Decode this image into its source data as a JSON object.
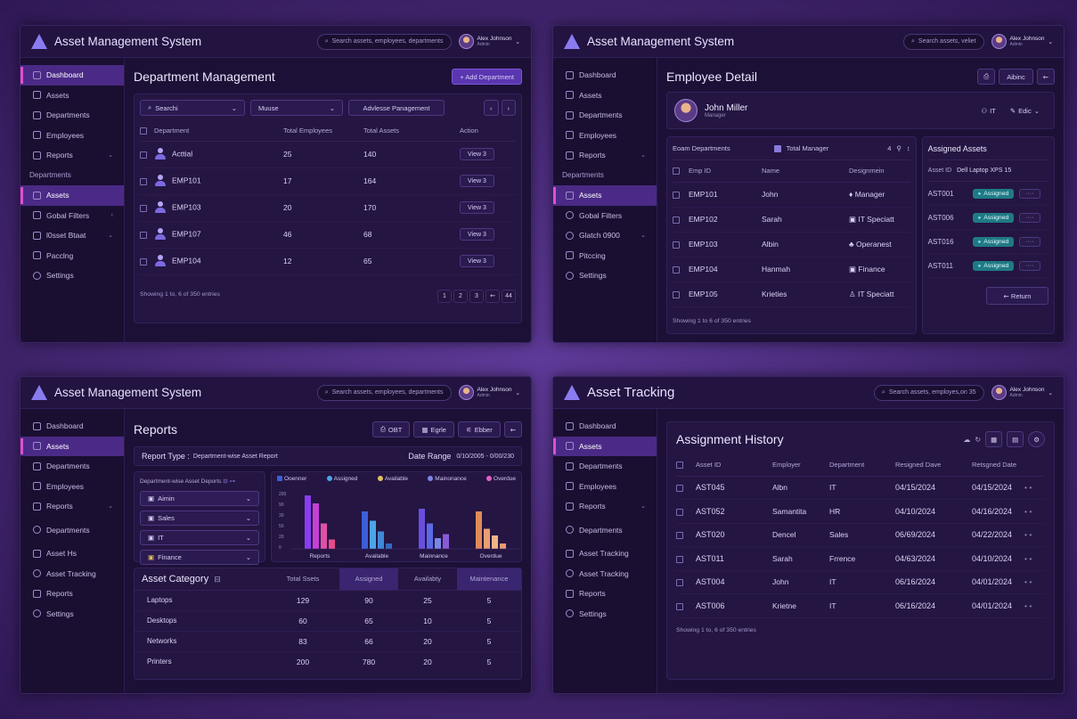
{
  "app_title": "Asset Management System",
  "user": {
    "name": "Alex Johnson",
    "role": "Admin"
  },
  "panel1": {
    "search": "Search assets, employees, departments",
    "nav": [
      {
        "label": "Dashboard",
        "chev": ""
      },
      {
        "label": "Assets",
        "chev": ""
      },
      {
        "label": "Departments",
        "chev": ""
      },
      {
        "label": "Employees",
        "chev": ""
      },
      {
        "label": "Reports",
        "chev": "⌄"
      },
      {
        "label": "Departments",
        "chev": ""
      },
      {
        "label": "Assets",
        "chev": ""
      },
      {
        "label": "Gobal Filters",
        "chev": "‹"
      },
      {
        "label": "l0sset Btaat",
        "chev": "⌄"
      },
      {
        "label": "Pacclng",
        "chev": ""
      },
      {
        "label": "Settings",
        "chev": ""
      }
    ],
    "title": "Department Management",
    "add_button": "+ Add Department",
    "filter_search": "Searchi",
    "filter_2": "Muuse",
    "filter_3": "Advlesse Panagement",
    "columns": [
      "Department",
      "Total Employees",
      "Total Assets",
      "Action"
    ],
    "rows": [
      {
        "dept": "Acttial",
        "emp": "25",
        "assets": "140",
        "action": "View 3"
      },
      {
        "dept": "EMP101",
        "emp": "17",
        "assets": "164",
        "action": "View 3"
      },
      {
        "dept": "EMP103",
        "emp": "20",
        "assets": "170",
        "action": "View 3"
      },
      {
        "dept": "EMP107",
        "emp": "46",
        "assets": "68",
        "action": "View 3"
      },
      {
        "dept": "EMP104",
        "emp": "12",
        "assets": "65",
        "action": "View 3"
      }
    ],
    "footer": "Showing 1 to, 6 of 350 entries",
    "pages": [
      "1",
      "2",
      "3",
      "⇜",
      "44"
    ]
  },
  "panel2": {
    "search": "Search assets, veliet",
    "nav": [
      {
        "label": "Dashboard",
        "chev": ""
      },
      {
        "label": "Assets",
        "chev": ""
      },
      {
        "label": "Departments",
        "chev": ""
      },
      {
        "label": "Employees",
        "chev": ""
      },
      {
        "label": "Reports",
        "chev": "⌄"
      },
      {
        "label": "Departments",
        "chev": ""
      },
      {
        "label": "Assets",
        "chev": ""
      },
      {
        "label": "Gobal Filters",
        "chev": ""
      },
      {
        "label": "Glatch 0900",
        "chev": "⌄"
      },
      {
        "label": "Pitccing",
        "chev": ""
      },
      {
        "label": "Settings",
        "chev": ""
      }
    ],
    "title": "Employee Detail",
    "top_button": "Aibinc",
    "employee": {
      "name": "John Miller",
      "role": "Manager",
      "dept": "IT",
      "edit": "Edic"
    },
    "bar_left": "Eoam Departments",
    "bar_mid": "Total Manager",
    "bar_count": "4",
    "columns": [
      "Emp ID",
      "Name",
      "Designmein"
    ],
    "rows": [
      {
        "id": "EMP101",
        "name": "John",
        "role": "Manager"
      },
      {
        "id": "EMP102",
        "name": "Sarah",
        "role": "IT Speciatt"
      },
      {
        "id": "EMP103",
        "name": "Albin",
        "role": "Operanest"
      },
      {
        "id": "EMP104",
        "name": "Hanmah",
        "role": "Finance"
      },
      {
        "id": "EMP105",
        "name": "Krieties",
        "role": "IT Speciatt"
      }
    ],
    "footer": "Showing 1 to 6 of 350 entries",
    "assigned": {
      "title": "Assigned Assets",
      "col1": "Asset ID",
      "col2": "Dell Laptop XPS 15",
      "rows": [
        {
          "id": "AST001",
          "status": "Assigned"
        },
        {
          "id": "AST006",
          "status": "Assigned"
        },
        {
          "id": "AST016",
          "status": "Assigned"
        },
        {
          "id": "AST011",
          "status": "Assigned"
        }
      ],
      "return": "⇜ Return"
    }
  },
  "panel3": {
    "search": "Search assets, employees, departments",
    "nav": [
      {
        "label": "Dashboard",
        "chev": ""
      },
      {
        "label": "Assets",
        "chev": ""
      },
      {
        "label": "Departments",
        "chev": ""
      },
      {
        "label": "Employees",
        "chev": ""
      },
      {
        "label": "Reports",
        "chev": "⌄"
      },
      {
        "label": "Departments",
        "chev": ""
      },
      {
        "label": "Asset Hs",
        "chev": ""
      },
      {
        "label": "Asset Tracking",
        "chev": ""
      },
      {
        "label": "Reports",
        "chev": ""
      },
      {
        "label": "Settings",
        "chev": ""
      }
    ],
    "title": "Reports",
    "buttons": [
      "OBT",
      "Egrle",
      "Ebber"
    ],
    "report_type_label": "Report Type :",
    "report_type": "Department-wise Asset Report",
    "date_label": "Date Range",
    "date_value": "0/10/2005  -  0/00/230",
    "filter_title": "Department-wise Asset Deports",
    "filters": [
      "Aimin",
      "Sales",
      "IT",
      "Finance"
    ],
    "legend": [
      "Ooenner",
      "Assigned",
      "Available",
      "Mainonance",
      "Overdue"
    ],
    "legend_colors": [
      "#3b5fd8",
      "#4aa6e8",
      "#e0c060",
      "#7a86e6",
      "#e060c0"
    ],
    "category_title": "Asset Category",
    "category_columns": [
      "Total Ssets",
      "Assigned",
      "Availabty",
      "Maintenance"
    ],
    "category_rows": [
      {
        "name": "Laptops",
        "v": [
          "129",
          "90",
          "25",
          "5"
        ]
      },
      {
        "name": "Desktops",
        "v": [
          "60",
          "65",
          "10",
          "5"
        ]
      },
      {
        "name": "Networks",
        "v": [
          "83",
          "66",
          "20",
          "5"
        ]
      },
      {
        "name": "Printers",
        "v": [
          "200",
          "780",
          "20",
          "5"
        ]
      }
    ]
  },
  "panel4": {
    "app_title": "Asset Tracking",
    "search": "Search assets, employes,on 35",
    "nav": [
      {
        "label": "Dashboard",
        "chev": ""
      },
      {
        "label": "Assets",
        "chev": ""
      },
      {
        "label": "Departments",
        "chev": ""
      },
      {
        "label": "Employees",
        "chev": ""
      },
      {
        "label": "Reports",
        "chev": "⌄"
      },
      {
        "label": "Departments",
        "chev": ""
      },
      {
        "label": "Asset Tracking",
        "chev": ""
      },
      {
        "label": "Asset Tracking",
        "chev": ""
      },
      {
        "label": "Reports",
        "chev": ""
      },
      {
        "label": "Settings",
        "chev": ""
      }
    ],
    "title": "Assignment History",
    "columns": [
      "Asset ID",
      "Employer",
      "Department",
      "Resigned Dave",
      "Retsgned Date"
    ],
    "rows": [
      {
        "id": "AST045",
        "emp": "Albn",
        "dept": "IT",
        "d1": "04/15/2024",
        "d2": "04/15/2024"
      },
      {
        "id": "AST052",
        "emp": "Samantita",
        "dept": "HR",
        "d1": "04/10/2024",
        "d2": "04/16/2024"
      },
      {
        "id": "AST020",
        "emp": "Dencel",
        "dept": "Sales",
        "d1": "06/69/2024",
        "d2": "04/22/2024"
      },
      {
        "id": "AST011",
        "emp": "Sarah",
        "dept": "Frrence",
        "d1": "04/63/2024",
        "d2": "04/10/2024"
      },
      {
        "id": "AST004",
        "emp": "John",
        "dept": "IT",
        "d1": "06/16/2024",
        "d2": "04/01/2024"
      },
      {
        "id": "AST006",
        "emp": "Krietne",
        "dept": "IT",
        "d1": "06/16/2024",
        "d2": "04/01/2024"
      }
    ],
    "footer": "Showing 1 to, 6 of 350 entries"
  },
  "chart_data": {
    "type": "bar",
    "categories": [
      "Reports",
      "Available",
      "Mainnance",
      "Overdue"
    ],
    "series": [
      {
        "name": "Ooenner",
        "values": [
          200,
          140,
          150,
          140
        ]
      },
      {
        "name": "Assigned",
        "values": [
          170,
          105,
          95,
          75
        ]
      },
      {
        "name": "Available",
        "values": [
          95,
          65,
          40,
          50
        ]
      },
      {
        "name": "Mainonance",
        "values": [
          35,
          20,
          55,
          20
        ]
      }
    ],
    "yticks": [
      "200",
      "90",
      "30",
      "50",
      "20",
      "0"
    ],
    "ylim": [
      0,
      220
    ],
    "bar_colors": [
      [
        "#8a3cf0",
        "#3b5fd8",
        "#6a4ee0",
        "#e08a5a"
      ],
      [
        "#c640d8",
        "#4aa6e8",
        "#5a6ae8",
        "#e8a070"
      ],
      [
        "#e04fa8",
        "#3d8ad8",
        "#7a86e6",
        "#f0b488"
      ],
      [
        "#e84a8a",
        "#2f6ac0",
        "#8a5ad8",
        "#e89a70"
      ]
    ]
  }
}
